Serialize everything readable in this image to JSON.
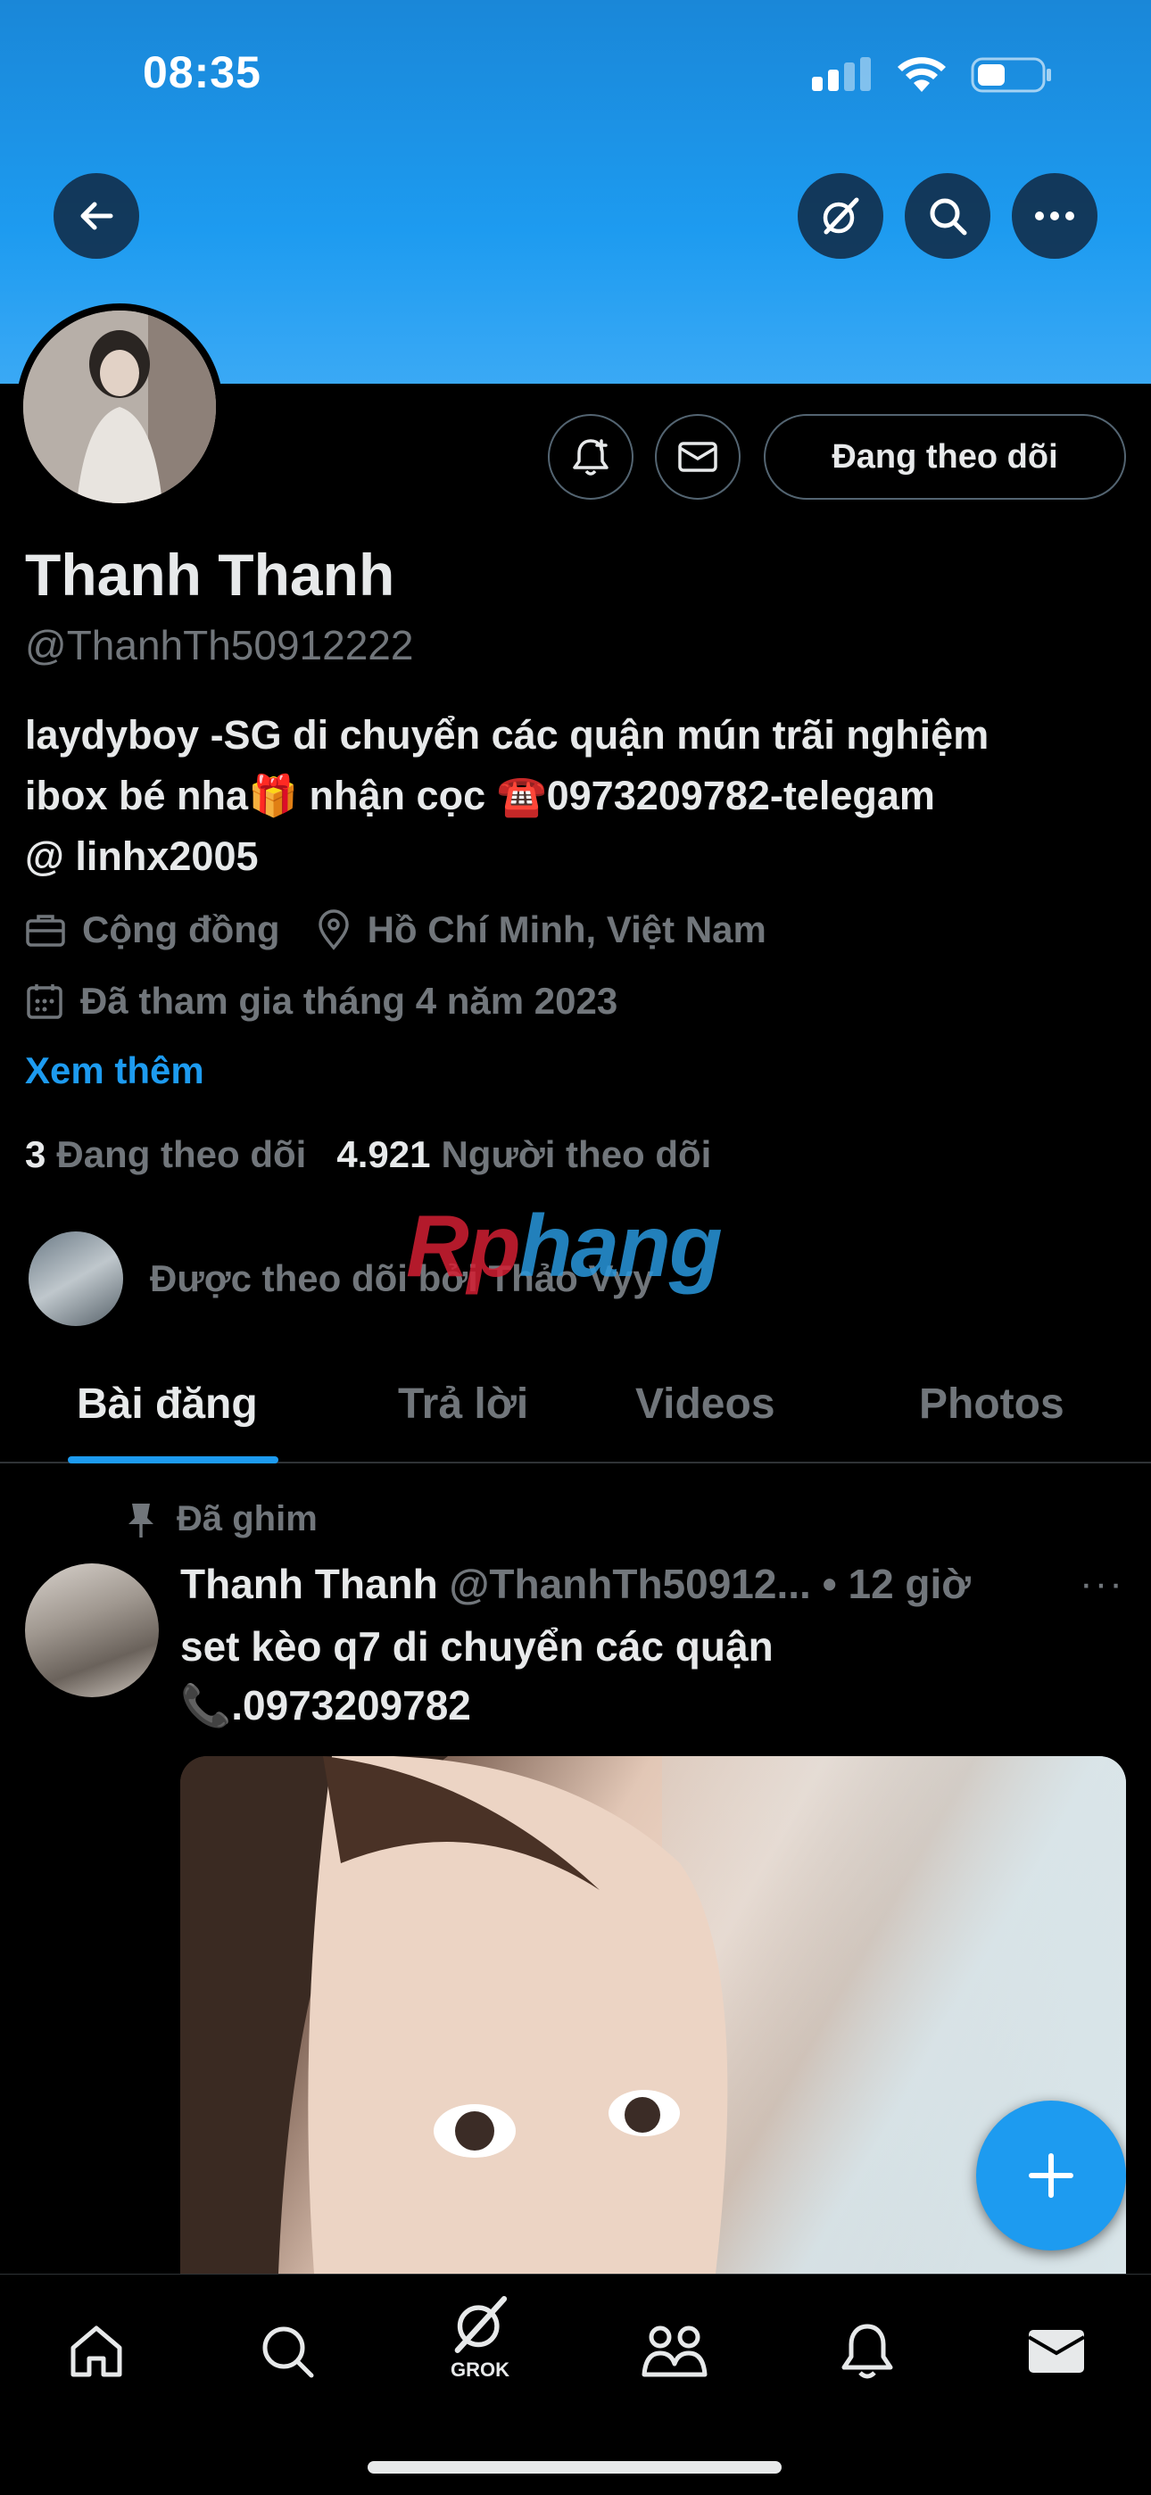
{
  "status_bar": {
    "time": "08:35"
  },
  "header": {
    "icons": [
      "back-arrow-icon",
      "grok-icon",
      "search-icon",
      "more-icon"
    ]
  },
  "profile": {
    "display_name": "Thanh Thanh",
    "handle": "@ThanhTh50912222",
    "bio_lines": [
      "laydyboy -SG di chuyển các quận mún trãi nghiệm",
      "ibox bé nha🎁 nhận cọc ☎️0973209782-telegam",
      "@ linhx2005"
    ],
    "category": "Cộng đồng",
    "location": "Hồ Chí Minh, Việt Nam",
    "joined": "Đã tham gia tháng 4 năm 2023",
    "see_more": "Xem thêm",
    "following_count": "3",
    "following_label": "Đang theo dõi",
    "followers_count": "4.921",
    "followers_label": "Người theo dõi",
    "followed_by": "Được theo dõi bởi Thảo Vyy",
    "follow_button": "Đang theo dõi"
  },
  "watermark": {
    "red": "Rp",
    "blue": "hang"
  },
  "tabs": [
    {
      "label": "Bài đăng",
      "active": true
    },
    {
      "label": "Trả lời",
      "active": false
    },
    {
      "label": "Videos",
      "active": false
    },
    {
      "label": "Photos",
      "active": false
    }
  ],
  "post": {
    "pinned_label": "Đã ghim",
    "author": "Thanh Thanh",
    "handle_time": "@ThanhTh50912... • 12 giờ",
    "more": "···",
    "text_line1": "set kèo q7 di chuyển các quận",
    "text_line2": "📞.0973209782"
  },
  "bottom_nav": {
    "items": [
      "home-icon",
      "search-icon",
      "grok-icon",
      "communities-icon",
      "notifications-icon",
      "messages-icon"
    ],
    "grok_label": "GROK"
  },
  "colors": {
    "accent": "#1d9bf0",
    "background": "#000000",
    "muted": "#71767b",
    "text": "#e7e9ea"
  }
}
